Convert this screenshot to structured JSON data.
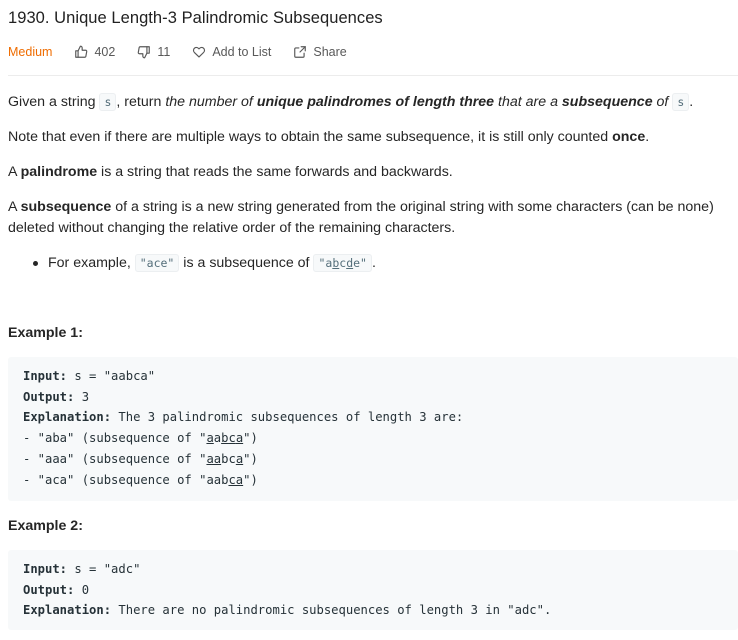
{
  "problem": {
    "title": "1930. Unique Length-3 Palindromic Subsequences",
    "difficulty": "Medium",
    "likes": "402",
    "dislikes": "11",
    "add_to_list": "Add to List",
    "share": "Share"
  },
  "description": {
    "p1": {
      "t1": "Given a string ",
      "code1": "s",
      "t2": ", return ",
      "i1": "the number of ",
      "b1": "unique palindromes of length three",
      "i2": " that are a ",
      "b2": "subsequence",
      "i3": " of ",
      "code2": "s",
      "t3": "."
    },
    "p2": {
      "t1": "Note that even if there are multiple ways to obtain the same subsequence, it is still only counted ",
      "b1": "once",
      "t2": "."
    },
    "p3": {
      "t1": "A ",
      "b1": "palindrome",
      "t2": " is a string that reads the same forwards and backwards."
    },
    "p4": {
      "t1": "A ",
      "b1": "subsequence",
      "t2": " of a string is a new string generated from the original string with some characters (can be none) deleted without changing the relative order of the remaining characters."
    },
    "bullet": {
      "t1": "For example, ",
      "code1": "\"ace\"",
      "t2": " is a subsequence of ",
      "code2a": "\"a",
      "code2b": "b",
      "code2c": "c",
      "code2d": "d",
      "code2e": "e\"",
      "t3": "."
    }
  },
  "examples": [
    {
      "title": "Example 1:",
      "input_label": "Input:",
      "input_value": " s = \"aabca\"",
      "output_label": "Output:",
      "output_value": " 3",
      "explanation_label": "Explanation:",
      "explanation_value": " The 3 palindromic subsequences of length 3 are:",
      "lines": [
        {
          "pre": "- \"aba\" (subsequence of \"",
          "u1": "a",
          "m1": "a",
          "u2": "b",
          "m2": "",
          "u3": "c",
          "m3": "",
          "u4": "a",
          "post": "\")"
        },
        {
          "pre": "- \"aaa\" (subsequence of \"",
          "u1": "aa",
          "m1": "bc",
          "u2": "a",
          "m2": "",
          "u3": "",
          "m3": "",
          "u4": "",
          "post": "\")"
        },
        {
          "pre": "- \"aca\" (subsequence of \"",
          "u1": "",
          "m1": "aab",
          "u2": "ca",
          "m2": "",
          "u3": "",
          "m3": "",
          "u4": "",
          "post": "\")"
        }
      ]
    },
    {
      "title": "Example 2:",
      "input_label": "Input:",
      "input_value": " s = \"adc\"",
      "output_label": "Output:",
      "output_value": " 0",
      "explanation_label": "Explanation:",
      "explanation_value": " There are no palindromic subsequences of length 3 in \"adc\"."
    }
  ],
  "icons": {
    "like": "thumbs-up-icon",
    "dislike": "thumbs-down-icon",
    "add": "heart-icon",
    "share": "share-icon"
  },
  "colors": {
    "difficulty": "#ef6c00",
    "text": "#262626",
    "muted": "#595959",
    "code_bg": "#f7f9fa"
  }
}
